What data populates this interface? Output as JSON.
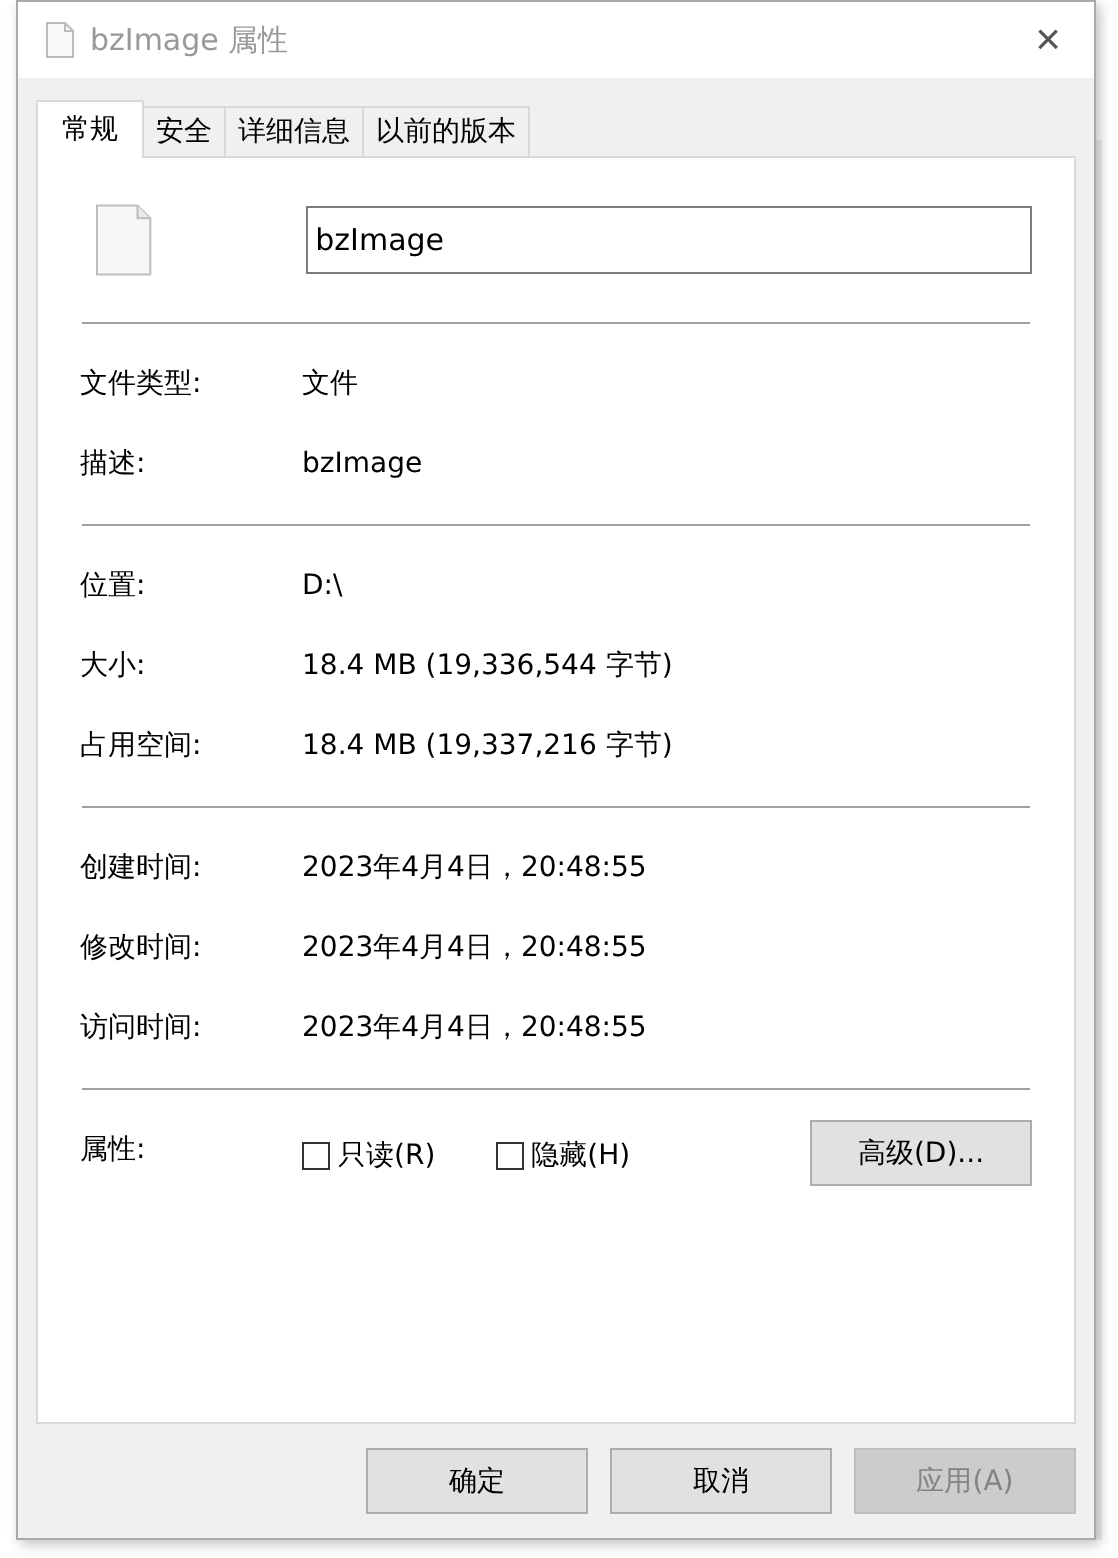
{
  "window": {
    "title": "bzImage 属性",
    "close": "×"
  },
  "tabs": [
    {
      "label": "常规",
      "selected": true
    },
    {
      "label": "安全",
      "selected": false
    },
    {
      "label": "详细信息",
      "selected": false
    },
    {
      "label": "以前的版本",
      "selected": false
    }
  ],
  "file_name": {
    "value": "bzImage"
  },
  "sections": [
    {
      "rows": [
        {
          "label": "文件类型:",
          "value": "文件"
        },
        {
          "label": "描述:",
          "value": "bzImage"
        }
      ]
    },
    {
      "rows": [
        {
          "label": "位置:",
          "value": "D:\\"
        },
        {
          "label": "大小:",
          "value": "18.4 MB (19,336,544 字节)"
        },
        {
          "label": "占用空间:",
          "value": "18.4 MB (19,337,216 字节)"
        }
      ]
    },
    {
      "rows": [
        {
          "label": "创建时间:",
          "value": "2023年4月4日，20:48:55"
        },
        {
          "label": "修改时间:",
          "value": "2023年4月4日，20:48:55"
        },
        {
          "label": "访问时间:",
          "value": "2023年4月4日，20:48:55"
        }
      ]
    }
  ],
  "attributes": {
    "label": "属性:",
    "checkboxes": [
      {
        "label": "只读(R)",
        "checked": false
      },
      {
        "label": "隐藏(H)",
        "checked": false
      }
    ],
    "advanced_button": "高级(D)..."
  },
  "buttons": [
    {
      "label": "确定",
      "disabled": false
    },
    {
      "label": "取消",
      "disabled": false
    },
    {
      "label": "应用(A)",
      "disabled": true
    }
  ]
}
